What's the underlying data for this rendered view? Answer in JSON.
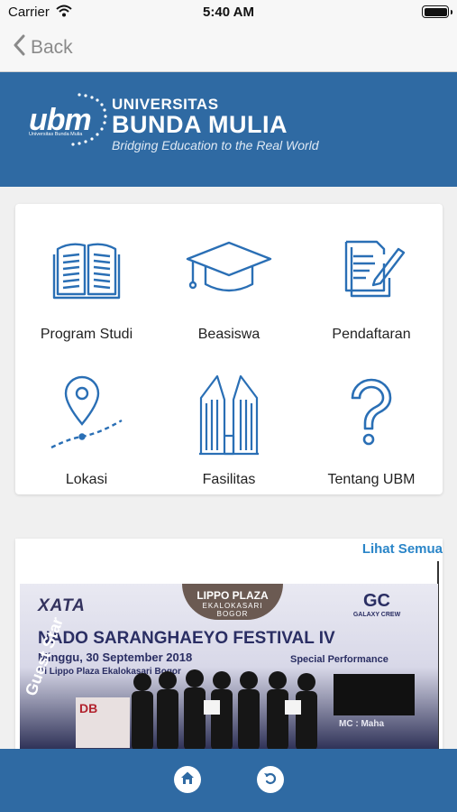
{
  "status_bar": {
    "carrier": "Carrier",
    "time": "5:40 AM"
  },
  "nav": {
    "back_label": "Back"
  },
  "header": {
    "logo_mark": "ubm",
    "logo_mark_sub": "Universitas Bunda Mulia",
    "title_line1": "UNIVERSITAS",
    "title_line2": "BUNDA MULIA",
    "tagline": "Bridging Education to the Real World",
    "brand_color": "#2f6aa3"
  },
  "menu": {
    "items": [
      {
        "label": "Program Studi",
        "icon": "open-book-icon"
      },
      {
        "label": "Beasiswa",
        "icon": "graduation-cap-icon"
      },
      {
        "label": "Pendaftaran",
        "icon": "form-pen-icon"
      },
      {
        "label": "Lokasi",
        "icon": "map-pin-route-icon"
      },
      {
        "label": "Fasilitas",
        "icon": "buildings-icon"
      },
      {
        "label": "Tentang UBM",
        "icon": "question-mark-icon"
      }
    ],
    "icon_color": "#2a6fb5"
  },
  "news": {
    "see_all_label": "Lihat Semua",
    "banner": {
      "xata": "XATA",
      "lippo": "LIPPO PLAZA",
      "lippo_sub": "EKALOKASARI",
      "lippo_city": "BOGOR",
      "title": "NADO SARANGHAEYO FESTIVAL IV",
      "date": "Minggu, 30 September 2018",
      "venue": "Di Lippo Plaza Ekalokasari Bogor",
      "gc": "GC",
      "gc_sub": "GALAXY CREW",
      "special": "Special Performance",
      "mc": "MC : Maha",
      "guest": "Guest Star",
      "db": "DB"
    }
  },
  "bottom_bar": {
    "buttons": [
      {
        "name": "home",
        "icon": "home-icon"
      },
      {
        "name": "back",
        "icon": "undo-arrow-icon"
      }
    ]
  }
}
